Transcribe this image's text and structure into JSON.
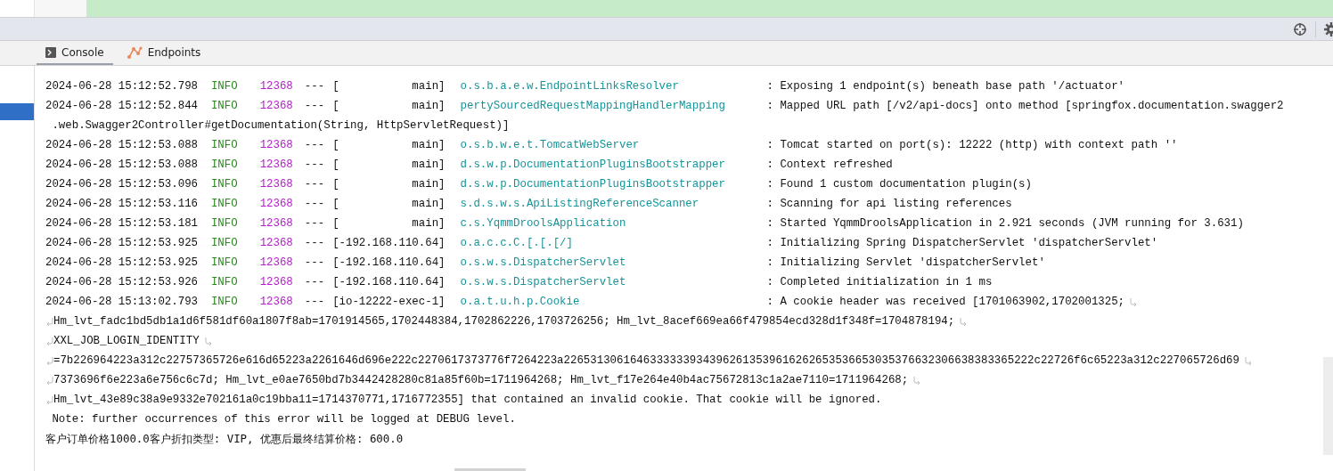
{
  "toolbar": {
    "icons": [
      {
        "kind": "crosshair"
      },
      {
        "kind": "settings"
      }
    ]
  },
  "tabs": [
    {
      "label": "Console",
      "kind": "terminal",
      "selected": true
    },
    {
      "label": "Endpoints",
      "kind": "endpoints",
      "selected": false
    }
  ],
  "log": [
    {
      "kind": "entry",
      "timestamp": "2024-06-28 15:12:52.798",
      "level": "INFO",
      "pid": "12368",
      "separator": "---",
      "thread": "[           main]",
      "logger": "o.s.b.a.e.w.EndpointLinksResolver",
      "message": ": Exposing 1 endpoint(s) beneath base path '/actuator'",
      "wrap_out": false
    },
    {
      "kind": "entry",
      "timestamp": "2024-06-28 15:12:52.844",
      "level": "INFO",
      "pid": "12368",
      "separator": "---",
      "thread": "[           main]",
      "logger": "pertySourcedRequestMappingHandlerMapping",
      "message": ": Mapped URL path [/v2/api-docs] onto method [springfox.documentation.swagger2",
      "wrap_out": false
    },
    {
      "kind": "text",
      "text": ".web.Swagger2Controller#getDocumentation(String, HttpServletRequest)]",
      "wrap_in": false,
      "wrap_out": false
    },
    {
      "kind": "entry",
      "timestamp": "2024-06-28 15:12:53.088",
      "level": "INFO",
      "pid": "12368",
      "separator": "---",
      "thread": "[           main]",
      "logger": "o.s.b.w.e.t.TomcatWebServer",
      "message": ": Tomcat started on port(s): 12222 (http) with context path ''",
      "wrap_out": false
    },
    {
      "kind": "entry",
      "timestamp": "2024-06-28 15:12:53.088",
      "level": "INFO",
      "pid": "12368",
      "separator": "---",
      "thread": "[           main]",
      "logger": "d.s.w.p.DocumentationPluginsBootstrapper",
      "message": ": Context refreshed",
      "wrap_out": false
    },
    {
      "kind": "entry",
      "timestamp": "2024-06-28 15:12:53.096",
      "level": "INFO",
      "pid": "12368",
      "separator": "---",
      "thread": "[           main]",
      "logger": "d.s.w.p.DocumentationPluginsBootstrapper",
      "message": ": Found 1 custom documentation plugin(s)",
      "wrap_out": false
    },
    {
      "kind": "entry",
      "timestamp": "2024-06-28 15:12:53.116",
      "level": "INFO",
      "pid": "12368",
      "separator": "---",
      "thread": "[           main]",
      "logger": "s.d.s.w.s.ApiListingReferenceScanner",
      "message": ": Scanning for api listing references",
      "wrap_out": false
    },
    {
      "kind": "entry",
      "timestamp": "2024-06-28 15:12:53.181",
      "level": "INFO",
      "pid": "12368",
      "separator": "---",
      "thread": "[           main]",
      "logger": "c.s.YqmmDroolsApplication",
      "message": ": Started YqmmDroolsApplication in 2.921 seconds (JVM running for 3.631)",
      "wrap_out": false
    },
    {
      "kind": "entry",
      "timestamp": "2024-06-28 15:12:53.925",
      "level": "INFO",
      "pid": "12368",
      "separator": "---",
      "thread": "[-192.168.110.64]",
      "logger": "o.a.c.c.C.[.[.[/]",
      "message": ": Initializing Spring DispatcherServlet 'dispatcherServlet'",
      "wrap_out": false
    },
    {
      "kind": "entry",
      "timestamp": "2024-06-28 15:12:53.925",
      "level": "INFO",
      "pid": "12368",
      "separator": "---",
      "thread": "[-192.168.110.64]",
      "logger": "o.s.w.s.DispatcherServlet",
      "message": ": Initializing Servlet 'dispatcherServlet'",
      "wrap_out": false
    },
    {
      "kind": "entry",
      "timestamp": "2024-06-28 15:12:53.926",
      "level": "INFO",
      "pid": "12368",
      "separator": "---",
      "thread": "[-192.168.110.64]",
      "logger": "o.s.w.s.DispatcherServlet",
      "message": ": Completed initialization in 1 ms",
      "wrap_out": false
    },
    {
      "kind": "entry",
      "timestamp": "2024-06-28 15:13:02.793",
      "level": "INFO",
      "pid": "12368",
      "separator": "---",
      "thread": "[io-12222-exec-1]",
      "logger": "o.a.t.u.h.p.Cookie",
      "message": ": A cookie header was received [1701063902,1702001325;",
      "wrap_out": true
    },
    {
      "kind": "text",
      "text": "Hm_lvt_fadc1bd5db1a1d6f581df60a1807f8ab=1701914565,1702448384,1702862226,1703726256; Hm_lvt_8acef669ea66f479854ecd328d1f348f=1704878194;",
      "wrap_in": true,
      "wrap_out": true
    },
    {
      "kind": "text",
      "text": "XXL_JOB_LOGIN_IDENTITY",
      "wrap_in": true,
      "wrap_out": true
    },
    {
      "kind": "text",
      "text": "=7b226964223a312c22757365726e616d65223a2261646d696e222c2270617373776f7264223a22653130616463333339343962613539616262653536653035376632306638383365222c22726f6c65223a312c227065726d69",
      "wrap_in": true,
      "wrap_out": true
    },
    {
      "kind": "text",
      "text": "7373696f6e223a6e756c6c7d; Hm_lvt_e0ae7650bd7b3442428280c81a85f60b=1711964268; Hm_lvt_f17e264e40b4ac75672813c1a2ae7110=1711964268;",
      "wrap_in": true,
      "wrap_out": true
    },
    {
      "kind": "text",
      "text": "Hm_lvt_43e89c38a9e9332e702161a0c19bba11=1714370771,1716772355] that contained an invalid cookie. That cookie will be ignored.",
      "wrap_in": true,
      "wrap_out": false
    },
    {
      "kind": "text",
      "text": "Note: further occurrences of this error will be logged at DEBUG level.",
      "wrap_in": false,
      "wrap_out": false
    },
    {
      "kind": "output",
      "text": "客户订单价格1000.0客户折扣类型: VIP, 优惠后最终结算价格: 600.0"
    }
  ]
}
